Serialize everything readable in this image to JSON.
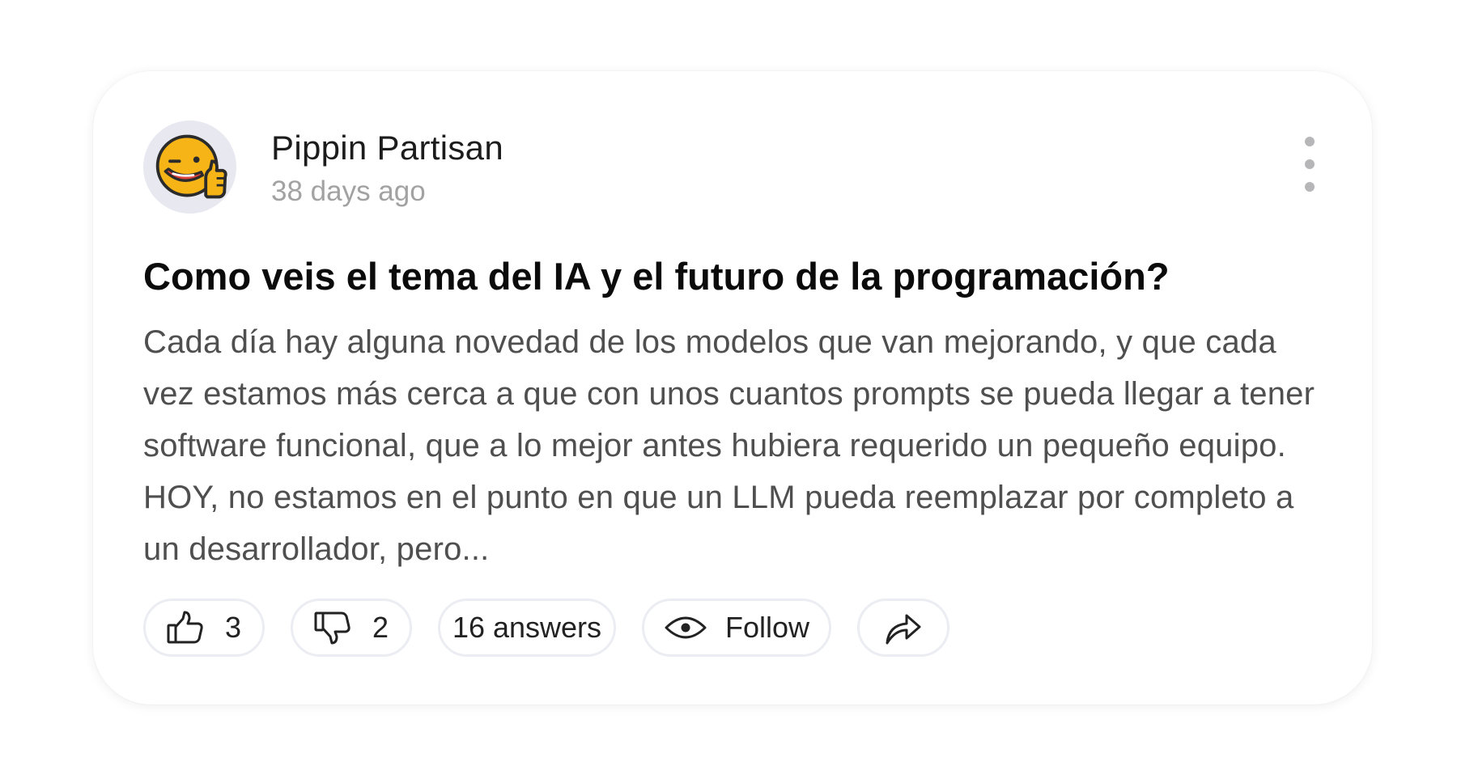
{
  "post": {
    "author": "Pippin Partisan",
    "timestamp": "38 days ago",
    "avatar_icon": "winking-thumbs-up-emoji",
    "menu_icon": "more-vertical-icon",
    "title": "Como veis el tema del IA y el futuro de la programación?",
    "body": "Cada día hay alguna novedad de los modelos que van mejorando, y que cada vez estamos más cerca a que con unos cuantos prompts se pueda llegar a tener software funcional, que a lo mejor antes hubiera requerido un pequeño equipo.  HOY, no estamos en el punto en que un LLM pueda reemplazar por completo a un desarrollador, pero..."
  },
  "actions": {
    "likes": "3",
    "dislikes": "2",
    "answers": "16 answers",
    "follow": "Follow",
    "like_icon": "thumbs-up-icon",
    "dislike_icon": "thumbs-down-icon",
    "follow_icon": "eye-icon",
    "share_icon": "share-arrow-icon"
  },
  "colors": {
    "avatar_bg": "#e7e8f0",
    "emoji_yellow": "#f6b416",
    "pill_border": "#ecedf2",
    "body_text": "#4f4f4f",
    "muted_text": "#a2a2a2"
  }
}
